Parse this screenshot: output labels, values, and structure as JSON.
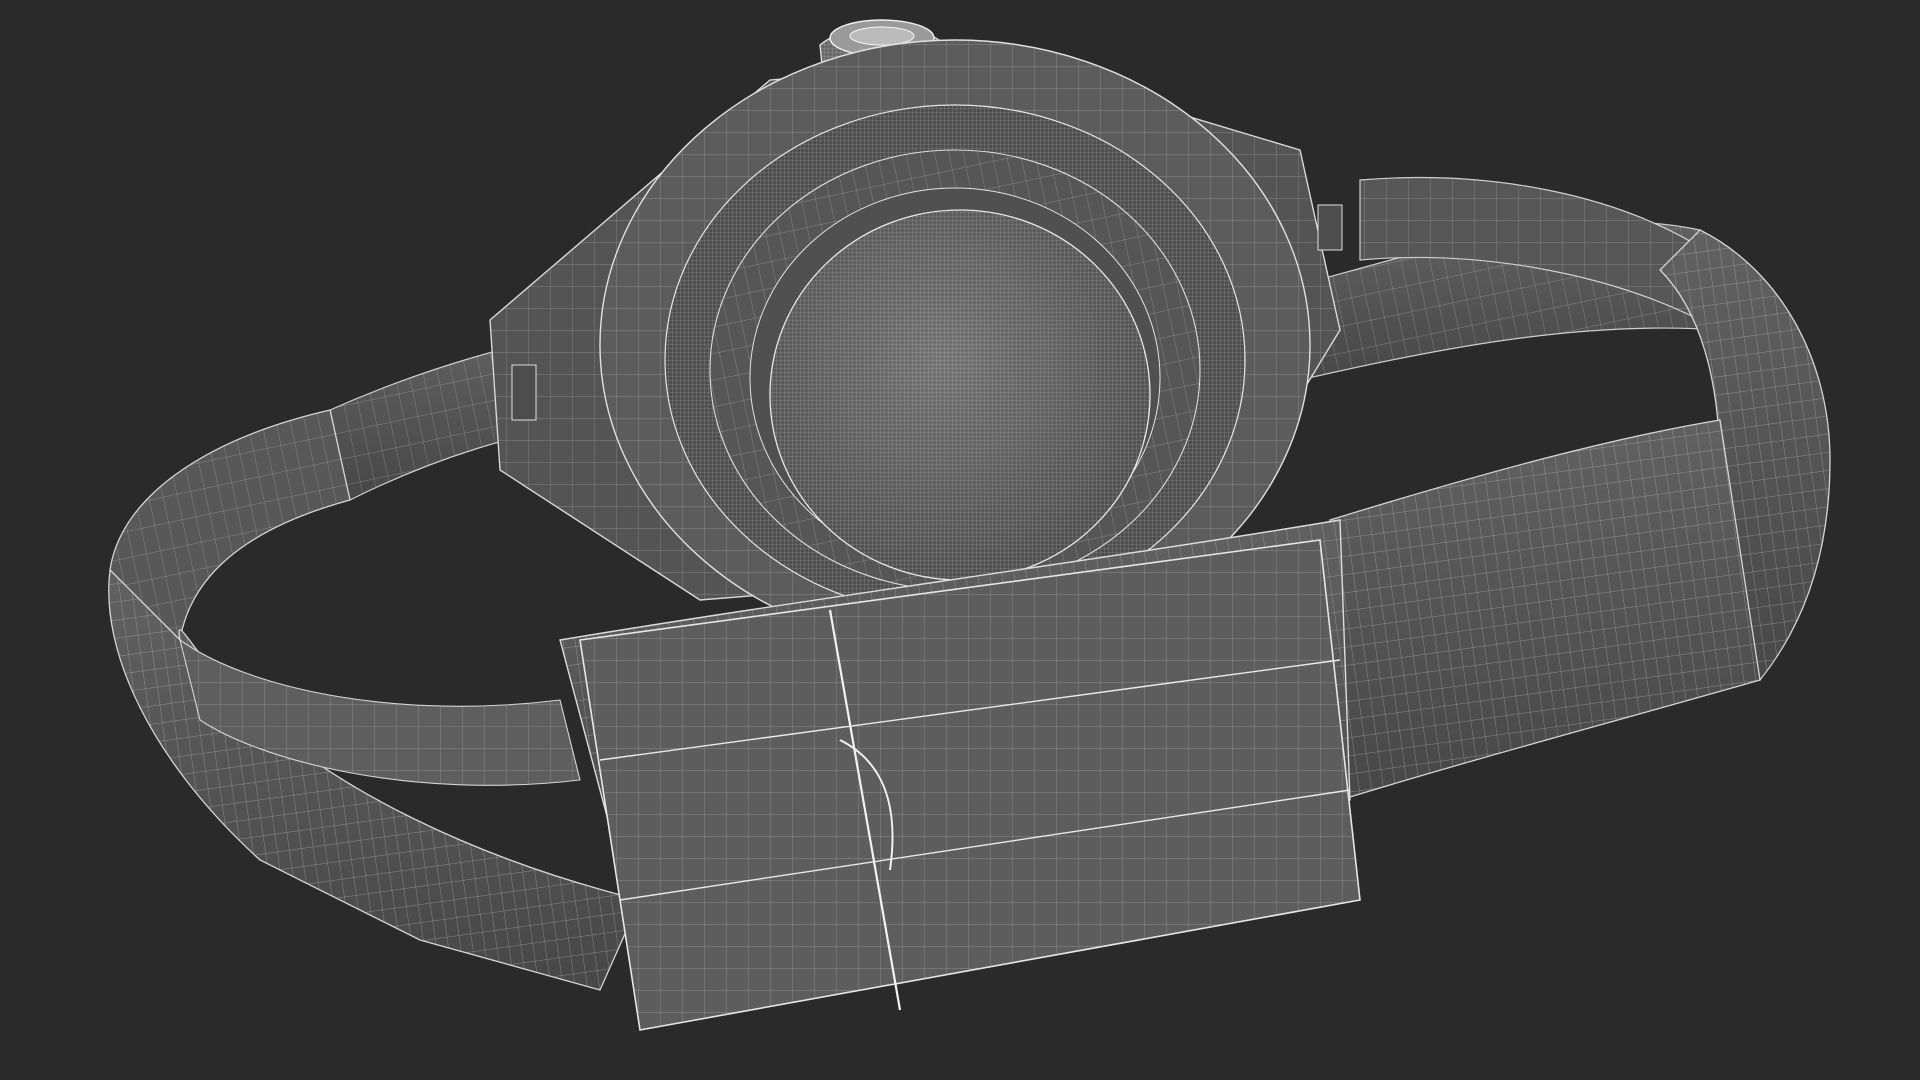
{
  "scene": {
    "subject": "wireframe-watch-render",
    "colors": {
      "background": "#2a2a2a",
      "surface_dark": "#4a4a4a",
      "surface_mid": "#5a5a5a",
      "surface_light": "#6a6a6a",
      "highlight": "#7a7a7a",
      "wire": "#bdbdbd",
      "wire_bright": "#e4e4e4"
    },
    "icons": {
      "crown": "crown-icon",
      "caseback": "caseback-icon",
      "bracelet": "bracelet-icon",
      "clasp": "clasp-icon"
    }
  }
}
